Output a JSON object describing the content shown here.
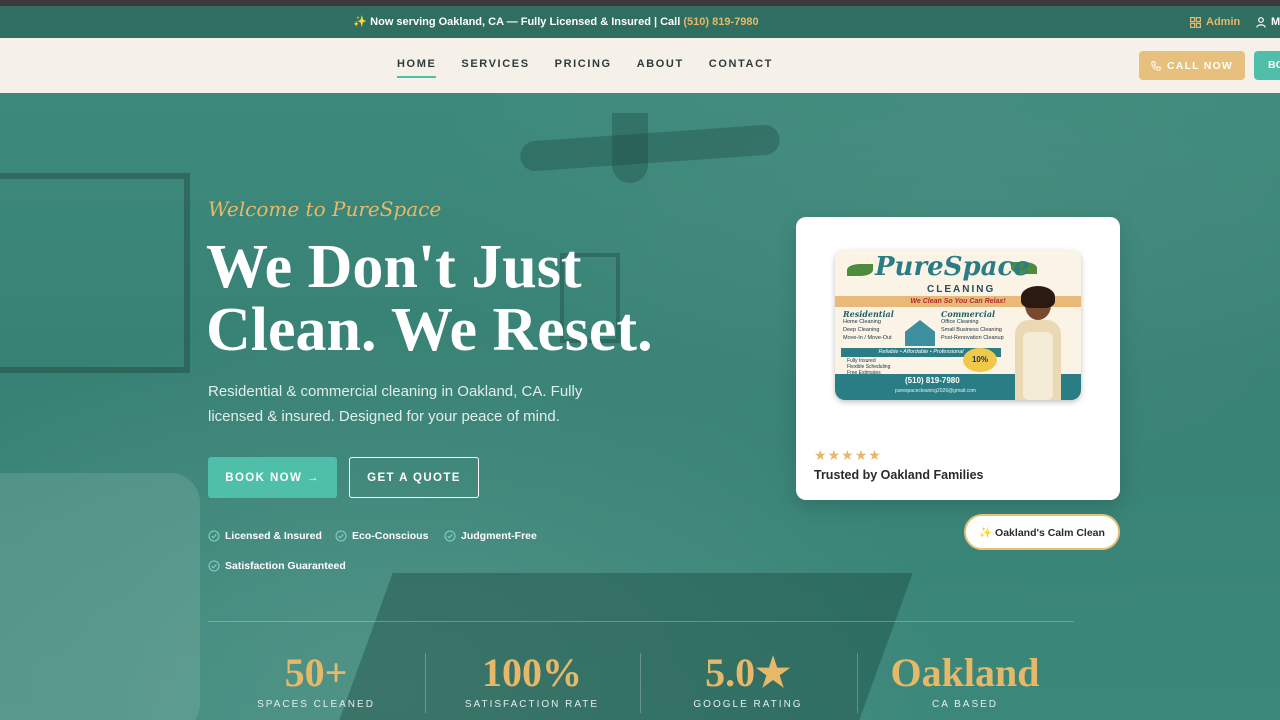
{
  "announcement": {
    "message": "✨ Now serving Oakland, CA — Fully Licensed & Insured | Call ",
    "phone": "(510) 819-7980",
    "admin_label": "Admin",
    "my_label": "M"
  },
  "nav": {
    "items": [
      "HOME",
      "SERVICES",
      "PRICING",
      "ABOUT",
      "CONTACT"
    ],
    "call_label": "CALL NOW",
    "book_label": "BO"
  },
  "hero": {
    "welcome": "Welcome to PureSpace",
    "headline_line1": "We Don't Just",
    "headline_line2": "Clean. We Reset.",
    "subtitle": "Residential & commercial cleaning in Oakland, CA. Fully licensed & insured. Designed for your peace of mind.",
    "book_label": "BOOK NOW →",
    "quote_label": "GET A QUOTE",
    "features": [
      "Licensed & Insured",
      "Eco-Conscious",
      "Judgment-Free",
      "Satisfaction Guaranteed"
    ]
  },
  "card": {
    "flyer": {
      "brand": "PureSpace",
      "brand_sub": "CLEANING",
      "tagline": "We Clean So You Can Relax!",
      "residential_title": "Residential",
      "residential_items": [
        "Home Cleaning",
        "Deep Cleaning",
        "Move-In / Move-Out"
      ],
      "commercial_title": "Commercial",
      "commercial_items": [
        "Office Cleaning",
        "Small Business Cleaning",
        "Post-Renovation Cleanup"
      ],
      "values": "Reliable • Affordable • Professional",
      "extras": [
        "Fully Insured",
        "Flexible Scheduling",
        "Free Estimates"
      ],
      "discount": "10% OFF",
      "phone": "(510) 819-7980",
      "email": "purespacecleaning2026@gmail.com"
    },
    "rating_stars": 5,
    "trusted": "Trusted by Oakland Families"
  },
  "pill": "✨ Oakland's Calm Clean",
  "stats": [
    {
      "value": "50+",
      "label": "SPACES CLEANED"
    },
    {
      "value": "100%",
      "label": "SATISFACTION RATE"
    },
    {
      "value": "5.0★",
      "label": "GOOGLE RATING"
    },
    {
      "value": "Oakland",
      "label": "CA BASED"
    }
  ],
  "colors": {
    "accent_teal": "#4fbfaa",
    "gold": "#e6b86a",
    "header_bg": "#2f6e60",
    "nav_bg": "#f6f1e8"
  }
}
